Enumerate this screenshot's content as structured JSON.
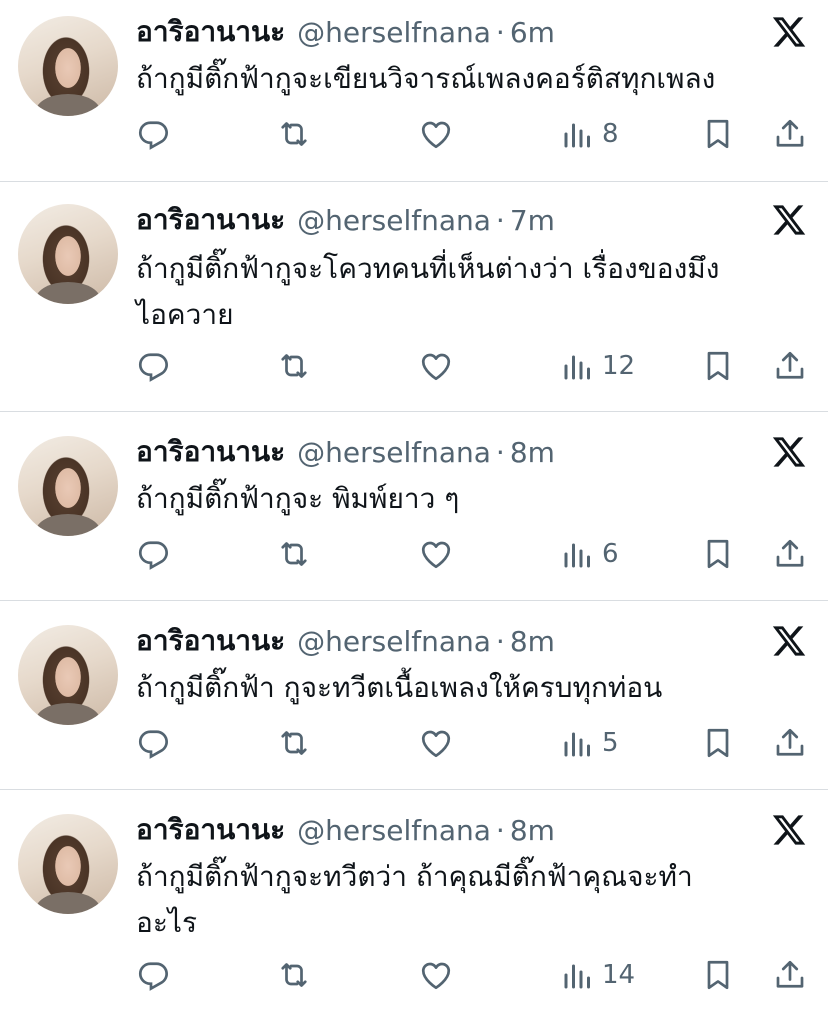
{
  "colors": {
    "text": "#0f1419",
    "muted": "#536471",
    "divider": "#d9dde1"
  },
  "tweets": [
    {
      "name": "อาริอานานะ",
      "handle": "@herselfnana",
      "separator": "·",
      "time": "6m",
      "lines": [
        "ถ้ากูมีติ๊กฟ้ากูจะเขียนวิจารณ์เพลงคอร์ติสทุกเพลง"
      ],
      "views": "8"
    },
    {
      "name": "อาริอานานะ",
      "handle": "@herselfnana",
      "separator": "·",
      "time": "7m",
      "lines": [
        "ถ้ากูมีติ๊กฟ้ากูจะโควทคนที่เห็นต่างว่า เรื่องของมึง",
        "ไอควาย"
      ],
      "views": "12"
    },
    {
      "name": "อาริอานานะ",
      "handle": "@herselfnana",
      "separator": "·",
      "time": "8m",
      "lines": [
        "ถ้ากูมีติ๊กฟ้ากูจะ พิมพ์ยาว ๆ"
      ],
      "views": "6"
    },
    {
      "name": "อาริอานานะ",
      "handle": "@herselfnana",
      "separator": "·",
      "time": "8m",
      "lines": [
        "ถ้ากูมีติ๊กฟ้า กูจะทวีตเนื้อเพลงให้ครบทุกท่อน"
      ],
      "views": "5"
    },
    {
      "name": "อาริอานานะ",
      "handle": "@herselfnana",
      "separator": "·",
      "time": "8m",
      "lines": [
        "ถ้ากูมีติ๊กฟ้ากูจะทวีตว่า ถ้าคุณมีติ๊กฟ้าคุณจะทำ",
        "อะไร"
      ],
      "views": "14"
    }
  ],
  "icons": {
    "reply": "reply-icon",
    "retweet": "retweet-icon",
    "like": "heart-icon",
    "views": "views-chart-icon",
    "bookmark": "bookmark-icon",
    "share": "share-icon",
    "brand": "x-logo-icon"
  }
}
